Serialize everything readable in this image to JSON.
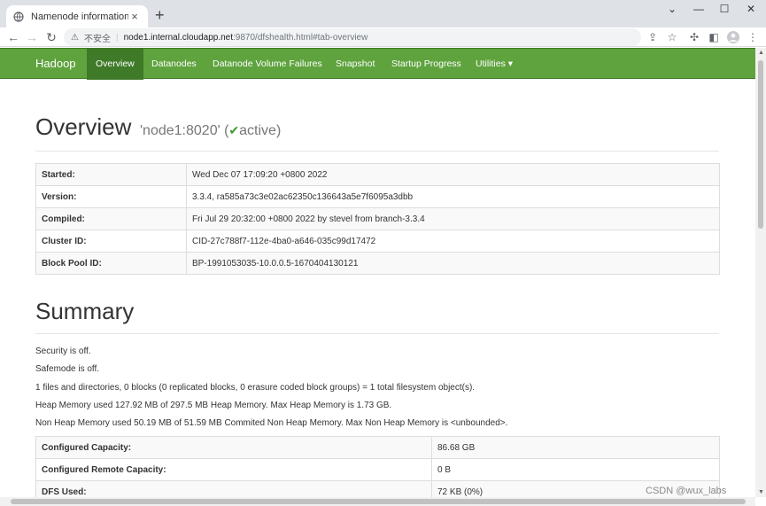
{
  "browser": {
    "tab_title": "Namenode information",
    "tab_close": "×",
    "new_tab": "+",
    "omnibox": {
      "security_label": "不安全",
      "host": "node1.internal.cloudapp.net",
      "path": ":9870/dfshealth.html#tab-overview"
    }
  },
  "navbar": {
    "brand": "Hadoop",
    "items": [
      {
        "label": "Overview",
        "active": true
      },
      {
        "label": "Datanodes"
      },
      {
        "label": "Datanode Volume Failures"
      },
      {
        "label": "Snapshot"
      },
      {
        "label": "Startup Progress"
      },
      {
        "label": "Utilities ▾"
      }
    ]
  },
  "overview": {
    "title": "Overview",
    "node": "'node1:8020'",
    "state": "active",
    "rows": [
      {
        "key": "Started:",
        "value": "Wed Dec 07 17:09:20 +0800 2022"
      },
      {
        "key": "Version:",
        "value": "3.3.4, ra585a73c3e02ac62350c136643a5e7f6095a3dbb"
      },
      {
        "key": "Compiled:",
        "value": "Fri Jul 29 20:32:00 +0800 2022 by stevel from branch-3.3.4"
      },
      {
        "key": "Cluster ID:",
        "value": "CID-27c788f7-112e-4ba0-a646-035c99d17472"
      },
      {
        "key": "Block Pool ID:",
        "value": "BP-1991053035-10.0.0.5-1670404130121"
      }
    ]
  },
  "summary": {
    "title": "Summary",
    "lines": [
      "Security is off.",
      "Safemode is off.",
      "1 files and directories, 0 blocks (0 replicated blocks, 0 erasure coded block groups) = 1 total filesystem object(s).",
      "Heap Memory used 127.92 MB of 297.5 MB Heap Memory. Max Heap Memory is 1.73 GB.",
      "Non Heap Memory used 50.19 MB of 51.59 MB Commited Non Heap Memory. Max Non Heap Memory is <unbounded>."
    ],
    "rows": [
      {
        "key": "Configured Capacity:",
        "value": "86.68 GB"
      },
      {
        "key": "Configured Remote Capacity:",
        "value": "0 B"
      },
      {
        "key": "DFS Used:",
        "value": "72 KB (0%)"
      }
    ]
  },
  "watermark": "CSDN @wux_labs"
}
